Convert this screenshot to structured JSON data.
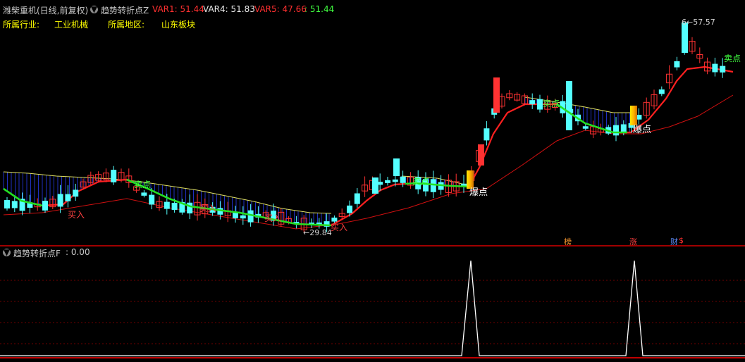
{
  "header": {
    "stock_title": "潍柴重机(日线,前复权)",
    "indicator_name": "趋势转折点Z",
    "var1_label": "VAR1: 51.44",
    "var4_label": "VAR4: 51.83",
    "var5_label": "VAR5: 47.66",
    "last_label": ": 51.44",
    "dropdown_icon": "chevron-down-icon"
  },
  "info": {
    "industry_label": "所属行业:",
    "industry_value": "工业机械",
    "region_label": "所属地区:",
    "region_value": "山东板块"
  },
  "main_chart": {
    "high_label": "57.57",
    "low_label": "29.84",
    "signals": {
      "buy": "买入",
      "sell": "卖点",
      "burst": "爆点"
    },
    "event_tags": {
      "rank": "榜",
      "rise": "涨",
      "finance": "财",
      "dollar": "$"
    }
  },
  "sub_chart": {
    "indicator_label": "趋势转折点F",
    "value_label": ": 0.00",
    "dropdown_icon": "chevron-down-icon"
  },
  "colors": {
    "background": "#000000",
    "up_candle": "#ff3232",
    "down_candle": "#54ffff",
    "ma_short": "#ff2020",
    "ma_long": "#d01010",
    "green_line": "#22e022",
    "envelope": "#e0e060",
    "fill": "#2030c0",
    "spike": "#ffffff",
    "text_yellow": "#ffff00",
    "text_red": "#ff4040",
    "text_green": "#40ff40"
  }
}
